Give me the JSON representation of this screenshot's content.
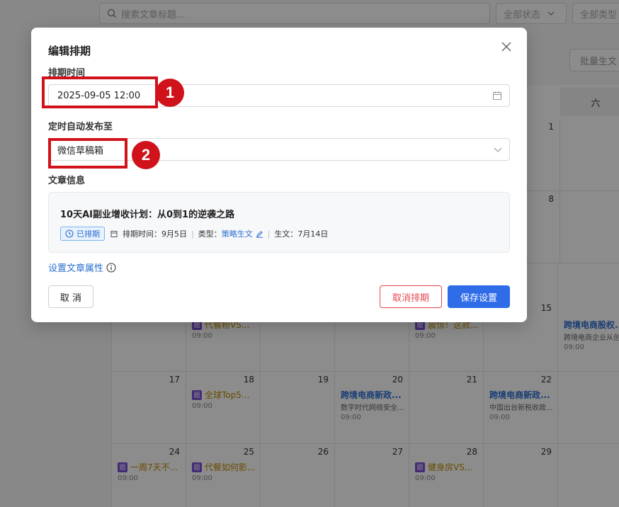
{
  "background": {
    "search_placeholder": "搜索文章标题...",
    "status_filter": "全部状态",
    "type_filter": "全部类型",
    "batch_button": "批量生文",
    "weekday_sat": "六",
    "days": [
      {
        "num": "1"
      },
      {
        "num": "8"
      },
      {
        "num": "15",
        "event": {
          "title": "跨境电商股权...",
          "sub": "跨境电商企业从创...",
          "time": "09:00",
          "style": "blue"
        }
      },
      {
        "num": "",
        "event": {
          "title": "代餐粉VS...",
          "time": "09:00",
          "tag": "题"
        }
      },
      {
        "num": "",
        "event": {
          "title": "震惊！这款...",
          "time": "09:00",
          "tag": "题"
        }
      },
      {
        "num": "17"
      },
      {
        "num": "18",
        "event": {
          "title": "全球Top5...",
          "time": "09:00",
          "tag": "题"
        }
      },
      {
        "num": "19"
      },
      {
        "num": "20",
        "event": {
          "title": "跨境电商新政...",
          "sub": "数字时代网络安全...",
          "time": "09:00",
          "style": "blue"
        }
      },
      {
        "num": "21"
      },
      {
        "num": "22",
        "event": {
          "title": "跨境电商新政...",
          "sub": "中国出台新税收政...",
          "time": "09:00",
          "style": "blue"
        }
      },
      {
        "num": "24",
        "event": {
          "title": "一周7天不...",
          "time": "09:00",
          "tag": "题"
        }
      },
      {
        "num": "25",
        "event": {
          "title": "代餐如何影...",
          "time": "09:00",
          "tag": "题"
        }
      },
      {
        "num": "26"
      },
      {
        "num": "27"
      },
      {
        "num": "28",
        "event": {
          "title": "健身房VS...",
          "time": "09:00",
          "tag": "题"
        }
      },
      {
        "num": "29"
      }
    ]
  },
  "modal": {
    "title": "编辑排期",
    "schedule_time_label": "排期时间",
    "schedule_time_value": "2025-09-05 12:00",
    "publish_to_label": "定时自动发布至",
    "publish_to_value": "微信草稿箱",
    "article_info_label": "文章信息",
    "article": {
      "title": "10天AI副业增收计划：从0到1的逆袭之路",
      "status_badge": "已排期",
      "schedule_time": "排期时间：9月5日",
      "type_prefix": "类型：",
      "type_value": "策略生文",
      "generated": "生文：7月14日"
    },
    "attr_link": "设置文章属性",
    "cancel_button": "取 消",
    "unschedule_button": "取消排期",
    "save_button": "保存设置"
  },
  "annotations": [
    "1",
    "2"
  ],
  "colors": {
    "primary": "#2f6de8",
    "danger": "#e5484d",
    "annotation": "#d0121b"
  }
}
